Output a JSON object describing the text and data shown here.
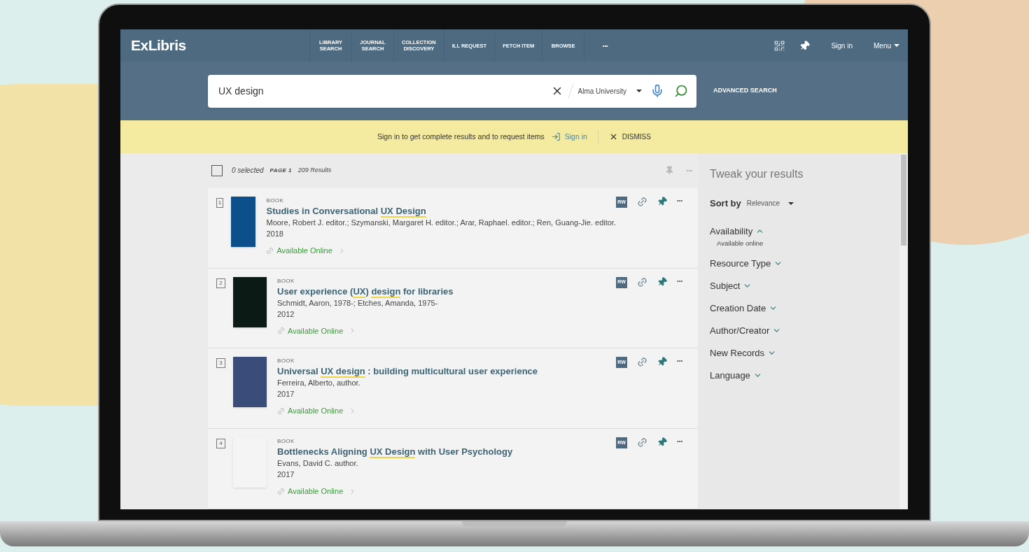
{
  "header": {
    "logo": "ExLibris",
    "nav": [
      {
        "label": "LIBRARY\nSEARCH"
      },
      {
        "label": "JOURNAL\nSEARCH"
      },
      {
        "label": "COLLECTION\nDISCOVERY"
      },
      {
        "label": "ILL REQUEST"
      },
      {
        "label": "FETCH ITEM"
      },
      {
        "label": "BROWSE"
      },
      {
        "label": "•••"
      }
    ],
    "sign_in": "Sign in",
    "menu": "Menu"
  },
  "search": {
    "value": "UX design",
    "scope": "Alma University",
    "advanced": "ADVANCED SEARCH"
  },
  "banner": {
    "message": "Sign in to get complete results and to request items",
    "sign_in": "Sign in",
    "dismiss": "DISMISS"
  },
  "results_header": {
    "selected": "0 selected",
    "page": "PAGE 1",
    "count": "209 Results",
    "checked": false,
    "more": "•••"
  },
  "results": [
    {
      "number": "1",
      "type": "BOOK",
      "title": [
        {
          "text": "Studies in Conversational ",
          "highlight": false
        },
        {
          "text": "UX Design",
          "highlight": true
        }
      ],
      "authors": "Moore, Robert J. editor.; Szymanski, Margaret H. editor.; Arar, Raphael. editor.; Ren, Guang-Jie. editor.",
      "year": "2018",
      "availability": "Available Online",
      "badge": "RW",
      "more": "•••"
    },
    {
      "number": "2",
      "type": "BOOK",
      "title": [
        {
          "text": "User experience (",
          "highlight": false
        },
        {
          "text": "UX",
          "highlight": true
        },
        {
          "text": ") ",
          "highlight": false
        },
        {
          "text": "design",
          "highlight": true
        },
        {
          "text": " for libraries",
          "highlight": false
        }
      ],
      "authors": "Schmidt, Aaron, 1978-; Etches, Amanda, 1975-",
      "year": "2012",
      "availability": "Available Online",
      "badge": "RW",
      "more": "•••"
    },
    {
      "number": "3",
      "type": "BOOK",
      "title": [
        {
          "text": "Universal ",
          "highlight": false
        },
        {
          "text": "UX design",
          "highlight": true
        },
        {
          "text": " : building multicultural user experience",
          "highlight": false
        }
      ],
      "authors": "Ferreira, Alberto, author.",
      "year": "2017",
      "availability": "Available Online",
      "badge": "RW",
      "more": "•••"
    },
    {
      "number": "4",
      "type": "BOOK",
      "title": [
        {
          "text": "Bottlenecks Aligning ",
          "highlight": false
        },
        {
          "text": "UX Design",
          "highlight": true
        },
        {
          "text": " with User Psychology",
          "highlight": false
        }
      ],
      "authors": "Evans, David C. author.",
      "year": "2017",
      "availability": "Available Online",
      "badge": "RW",
      "more": "•••"
    }
  ],
  "sidebar": {
    "title": "Tweak your results",
    "sort_label": "Sort by",
    "sort_value": "Relevance",
    "facets": [
      {
        "label": "Availability",
        "expanded": true,
        "children": [
          {
            "label": "Available online"
          }
        ]
      },
      {
        "label": "Resource Type",
        "expanded": false
      },
      {
        "label": "Subject",
        "expanded": false
      },
      {
        "label": "Creation Date",
        "expanded": false
      },
      {
        "label": "Author/Creator",
        "expanded": false
      },
      {
        "label": "New Records",
        "expanded": false
      },
      {
        "label": "Language",
        "expanded": false
      }
    ]
  }
}
